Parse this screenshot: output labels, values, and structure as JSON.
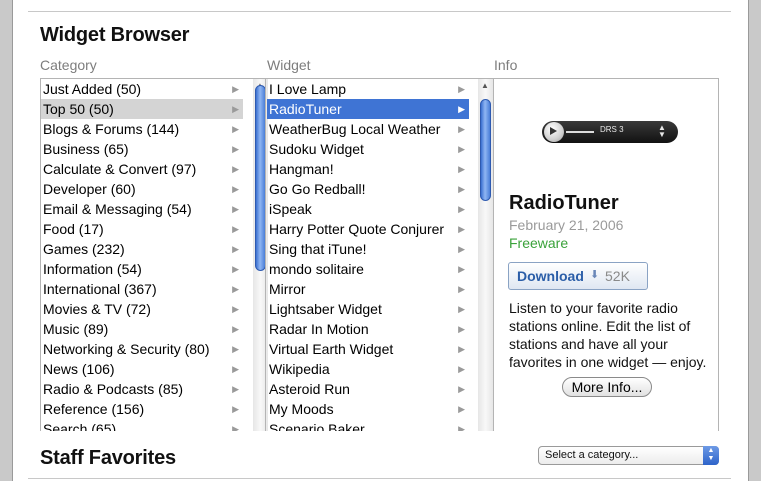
{
  "header": {
    "title": "Widget Browser",
    "columns": {
      "category": "Category",
      "widget": "Widget",
      "info": "Info"
    }
  },
  "categories": [
    {
      "label": "Just Added (50)"
    },
    {
      "label": "Top 50 (50)",
      "selected": true
    },
    {
      "label": "Blogs & Forums (144)"
    },
    {
      "label": "Business (65)"
    },
    {
      "label": "Calculate & Convert (97)"
    },
    {
      "label": "Developer (60)"
    },
    {
      "label": "Email & Messaging (54)"
    },
    {
      "label": "Food (17)"
    },
    {
      "label": "Games (232)"
    },
    {
      "label": "Information (54)"
    },
    {
      "label": "International (367)"
    },
    {
      "label": "Movies & TV (72)"
    },
    {
      "label": "Music (89)"
    },
    {
      "label": "Networking & Security (80)"
    },
    {
      "label": "News (106)"
    },
    {
      "label": "Radio & Podcasts (85)"
    },
    {
      "label": "Reference (156)"
    },
    {
      "label": "Search (65)"
    }
  ],
  "widgets": [
    {
      "label": "I Love Lamp"
    },
    {
      "label": "RadioTuner",
      "selected": true
    },
    {
      "label": "WeatherBug Local Weather"
    },
    {
      "label": "Sudoku Widget"
    },
    {
      "label": "Hangman!"
    },
    {
      "label": "Go Go Redball!"
    },
    {
      "label": "iSpeak"
    },
    {
      "label": "Harry Potter Quote Conjurer"
    },
    {
      "label": "Sing that iTune!"
    },
    {
      "label": "mondo solitaire"
    },
    {
      "label": "Mirror"
    },
    {
      "label": "Lightsaber Widget"
    },
    {
      "label": "Radar In Motion"
    },
    {
      "label": "Virtual Earth Widget"
    },
    {
      "label": "Wikipedia"
    },
    {
      "label": "Asteroid Run"
    },
    {
      "label": "My Moods"
    },
    {
      "label": "Scenario Baker"
    }
  ],
  "info": {
    "player_station": "DRS 3",
    "name": "RadioTuner",
    "date": "February 21, 2006",
    "license": "Freeware",
    "download_label": "Download",
    "download_size": "52K",
    "description": "Listen to your favorite radio stations online. Edit the list of stations and have all your favorites in one widget — enjoy.",
    "more_label": "More Info..."
  },
  "staff_favorites": {
    "title": "Staff Favorites",
    "select_value": "Select a category..."
  },
  "colors": {
    "selection_blue": "#3f74d4",
    "selection_gray": "#d4d4d4",
    "license_green": "#3aa23a",
    "link_blue": "#2b5ea8"
  },
  "icons": {
    "row_arrow": "disclosure-arrow-icon",
    "download_arrow": "download-arrow-icon"
  }
}
